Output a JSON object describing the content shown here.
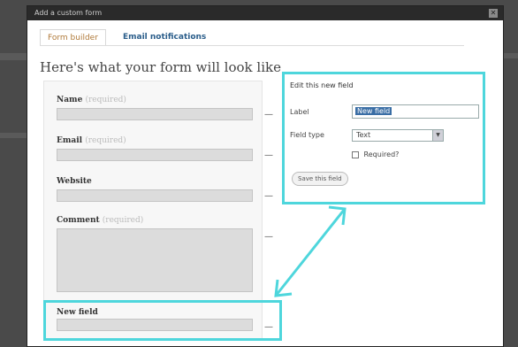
{
  "window": {
    "title": "Add a custom form",
    "close_glyph": "✕"
  },
  "tabs": [
    {
      "label": "Form builder",
      "active": true
    },
    {
      "label": "Email notifications",
      "active": false
    }
  ],
  "heading": "Here's what your form will look like",
  "form_fields": [
    {
      "label": "Name",
      "required_text": "(required)"
    },
    {
      "label": "Email",
      "required_text": "(required)"
    },
    {
      "label": "Website",
      "required_text": ""
    },
    {
      "label": "Comment",
      "required_text": "(required)"
    },
    {
      "label": "New field",
      "required_text": ""
    }
  ],
  "remove_glyph": "—",
  "edit_panel": {
    "title": "Edit this new field",
    "label_label": "Label",
    "label_value": "New field",
    "type_label": "Field type",
    "type_value": "Text",
    "required_label": "Required?",
    "required_checked": false,
    "save_label": "Save this field"
  },
  "colors": {
    "highlight": "#4ed6dc",
    "active_tab": "#b07a3a",
    "link_tab": "#2a5d8a"
  },
  "icons": {
    "close": "close-icon",
    "select_arrow": "chevron-down-icon"
  }
}
